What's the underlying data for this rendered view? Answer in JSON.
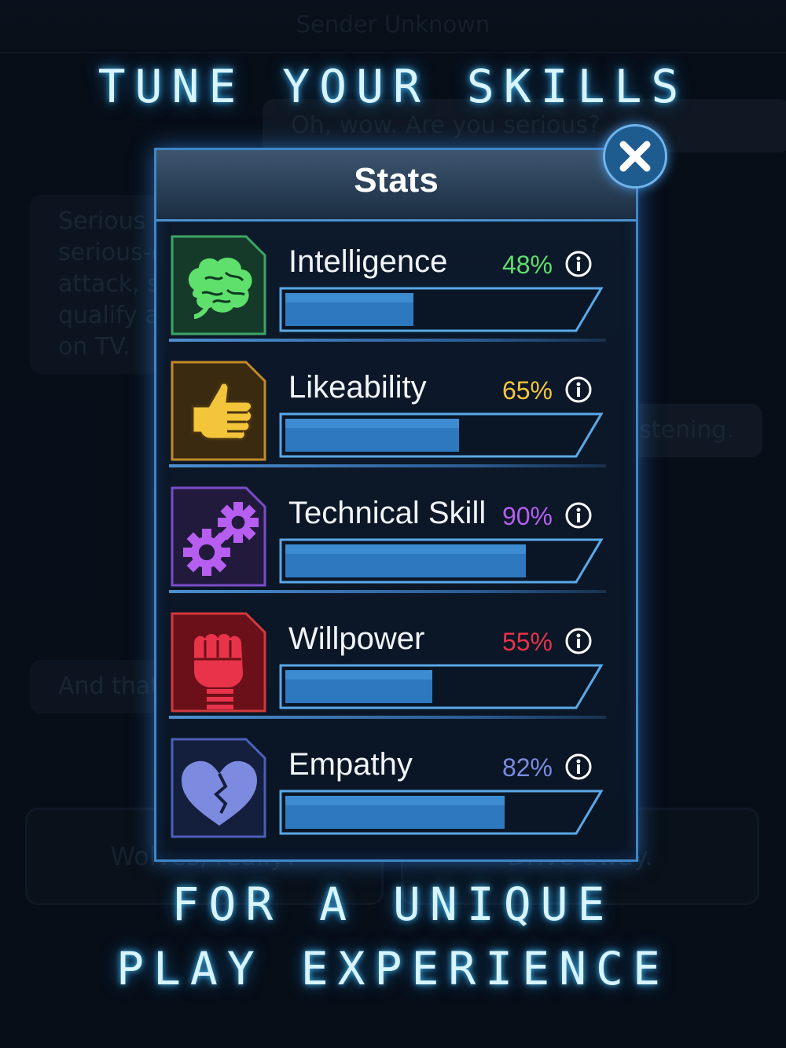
{
  "background": {
    "sender": "Sender Unknown",
    "bubbles": [
      {
        "text": "Oh, wow. Are you serious?",
        "side": "right"
      },
      {
        "text": "Serious as a heart attack. Maybe serious-er. I've never had a heart attack, so this could definitely qualify as a bigger deal than that on TV.",
        "side": "left"
      },
      {
        "text": "I'm listening.",
        "side": "right"
      },
      {
        "text": "And that's how it goes.",
        "side": "left"
      }
    ],
    "choices": [
      "Wolves, really?",
      "Drive away."
    ]
  },
  "headline_top": "TUNE YOUR SKILLS",
  "headline_bottom_line1": "FOR A UNIQUE",
  "headline_bottom_line2": "PLAY EXPERIENCE",
  "dialog": {
    "title": "Stats",
    "close_icon": "close-icon"
  },
  "stats": [
    {
      "name": "Intelligence",
      "percent_label": "48%",
      "value": 0.48,
      "color": "#5fe06c",
      "icon": "brain-icon",
      "icon_bg": "#163a2a",
      "icon_border": "#3da567"
    },
    {
      "name": "Likeability",
      "percent_label": "65%",
      "value": 0.65,
      "color": "#f2c53a",
      "icon": "thumbs-up-icon",
      "icon_bg": "#3a2a10",
      "icon_border": "#c48a2a"
    },
    {
      "name": "Technical Skill",
      "percent_label": "90%",
      "value": 0.9,
      "color": "#b65ef0",
      "icon": "gears-icon",
      "icon_bg": "#221a3d",
      "icon_border": "#7a4cc8"
    },
    {
      "name": "Willpower",
      "percent_label": "55%",
      "value": 0.55,
      "color": "#e8334a",
      "icon": "fist-icon",
      "icon_bg": "#6b1019",
      "icon_border": "#d23a3f"
    },
    {
      "name": "Empathy",
      "percent_label": "82%",
      "value": 0.82,
      "color": "#7c8ae0",
      "icon": "broken-heart-icon",
      "icon_bg": "#141f3d",
      "icon_border": "#4c5fb8"
    }
  ]
}
